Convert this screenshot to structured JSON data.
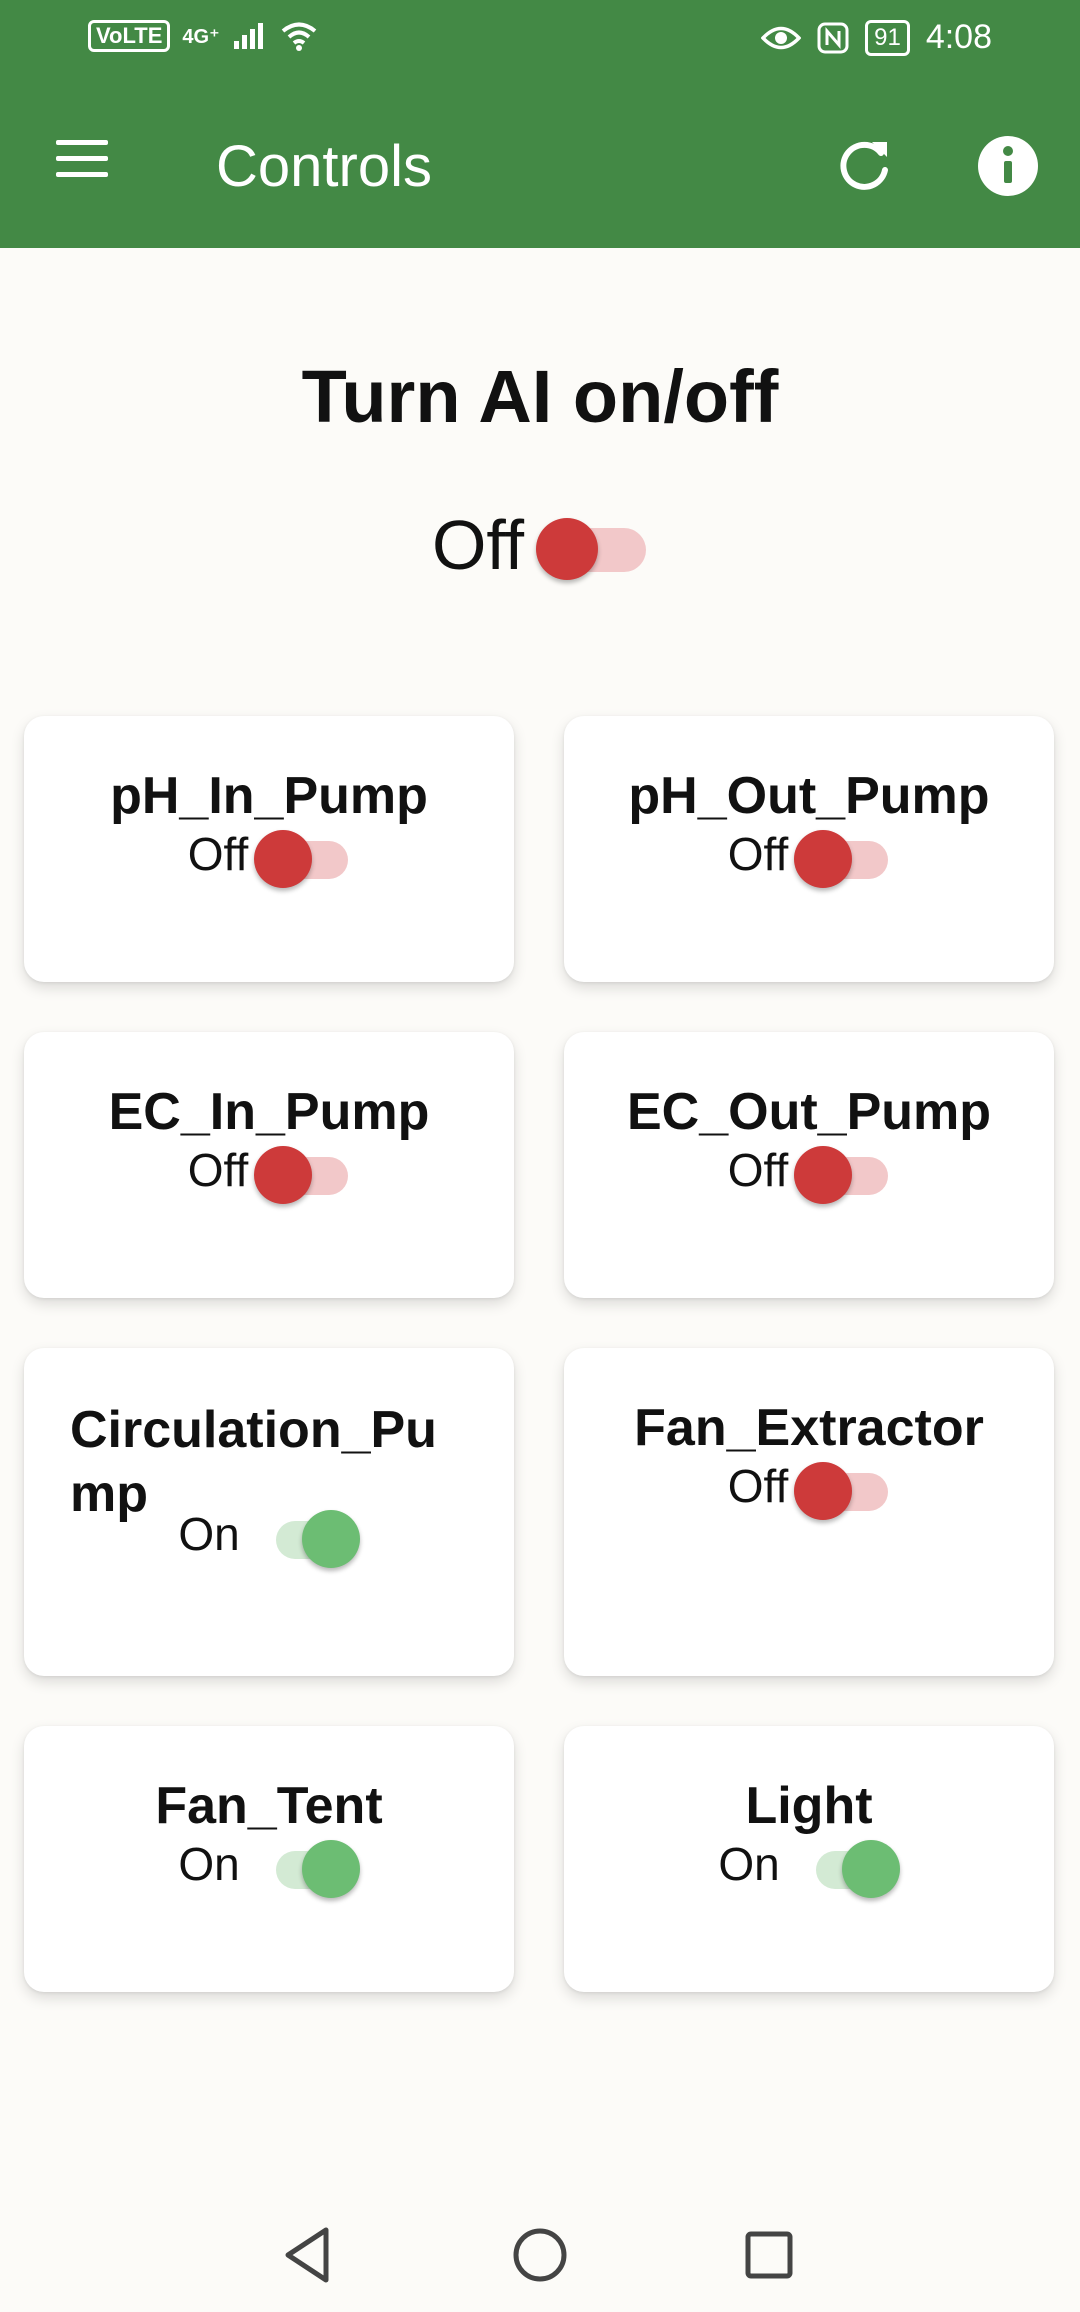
{
  "status_bar": {
    "volte": "VoLTE",
    "network": "4G⁺",
    "battery": "91",
    "time": "4:08"
  },
  "app_bar": {
    "title": "Controls",
    "background": "#438945"
  },
  "ai": {
    "title": "Turn AI on/off",
    "state": "Off",
    "on": false
  },
  "controls": [
    {
      "name": "pH_In_Pump",
      "state": "Off",
      "on": false
    },
    {
      "name": "pH_Out_Pump",
      "state": "Off",
      "on": false
    },
    {
      "name": "EC_In_Pump",
      "state": "Off",
      "on": false
    },
    {
      "name": "EC_Out_Pump",
      "state": "Off",
      "on": false
    },
    {
      "name": "Circulation_Pump",
      "display_name": "Circulation_Pu mp",
      "state": "On",
      "on": true
    },
    {
      "name": "Fan_Extractor",
      "state": "Off",
      "on": false
    },
    {
      "name": "Fan_Tent",
      "state": "On",
      "on": true
    },
    {
      "name": "Light",
      "state": "On",
      "on": true
    }
  ],
  "colors": {
    "off_thumb": "#cd3a3a",
    "off_track": "#f2c8c9",
    "on_thumb": "#6cbd73",
    "on_track": "#d3ead4"
  },
  "icons": {
    "menu": "menu-icon",
    "refresh": "refresh-icon",
    "info": "info-icon",
    "back": "back-icon",
    "home": "home-icon",
    "recents": "recents-icon"
  }
}
